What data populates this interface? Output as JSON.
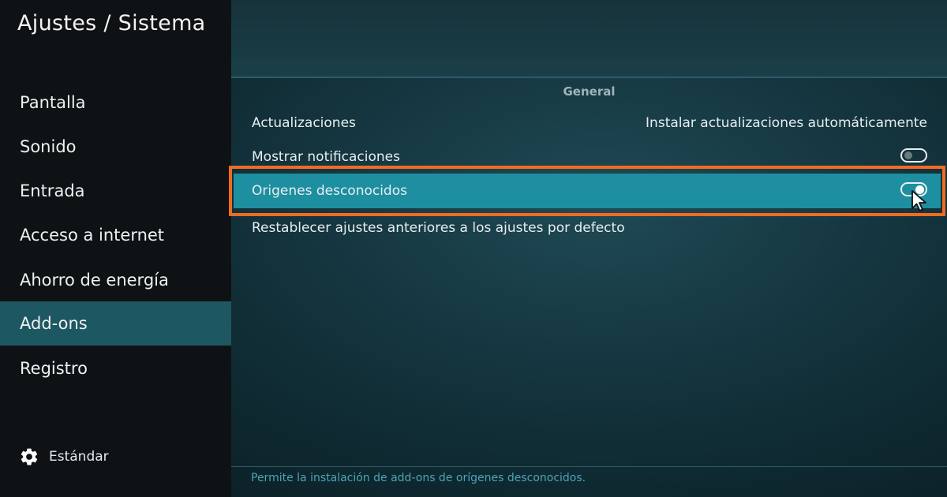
{
  "app": {
    "title": "Ajustes / Sistema"
  },
  "sidebar": {
    "items": [
      {
        "label": "Pantalla"
      },
      {
        "label": "Sonido"
      },
      {
        "label": "Entrada"
      },
      {
        "label": "Acceso a internet"
      },
      {
        "label": "Ahorro de energía"
      },
      {
        "label": "Add-ons"
      },
      {
        "label": "Registro"
      }
    ],
    "active_index": 5,
    "footer": {
      "icon": "gear-icon",
      "label": "Estándar"
    }
  },
  "main": {
    "section_title": "General",
    "rows": [
      {
        "label": "Actualizaciones",
        "value": "Instalar actualizaciones automáticamente"
      },
      {
        "label": "Mostrar notificaciones",
        "toggle": false
      },
      {
        "label": "Origenes desconocidos",
        "toggle": true,
        "focused": true
      },
      {
        "label": "Restablecer ajustes anteriores a los ajustes por defecto"
      }
    ],
    "help_text": "Permite la instalación de add-ons de orígenes desconocidos."
  },
  "colors": {
    "focus_highlight": "#1d8fa0",
    "annotation_box": "#f26b22",
    "active_sidebar": "#1d5761"
  }
}
